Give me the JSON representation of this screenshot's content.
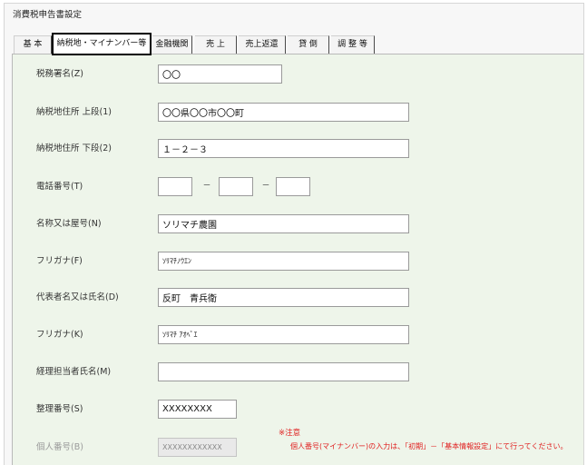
{
  "window": {
    "title": "消費税申告書設定"
  },
  "tabs": [
    {
      "label": "基 本",
      "selected": false
    },
    {
      "label": "納税地・マイナンバー等",
      "selected": true
    },
    {
      "label": "金融機関",
      "selected": false
    },
    {
      "label": "売 上",
      "selected": false
    },
    {
      "label": "売上返還",
      "selected": false
    },
    {
      "label": "貸 倒",
      "selected": false
    },
    {
      "label": "調 整 等",
      "selected": false
    }
  ],
  "form": {
    "tax_office": {
      "label": "税務署名(Z)",
      "value": "〇〇"
    },
    "address_upper": {
      "label": "納税地住所 上段(1)",
      "value": "〇〇県〇〇市〇〇町"
    },
    "address_lower": {
      "label": "納税地住所 下段(2)",
      "value": "１－２－３"
    },
    "phone": {
      "label": "電話番号(T)",
      "part1": "",
      "part2": "",
      "part3": "",
      "separator": "－"
    },
    "name": {
      "label": "名称又は屋号(N)",
      "value": "ソリマチ農園"
    },
    "name_kana": {
      "label": "フリガナ(F)",
      "value": "ｿﾘﾏﾁﾉｳｴﾝ"
    },
    "representative": {
      "label": "代表者名又は氏名(D)",
      "value": "反町　青兵衛"
    },
    "representative_kana": {
      "label": "フリガナ(K)",
      "value": "ｿﾘﾏﾁ ｱｵﾍﾞｴ"
    },
    "accountant": {
      "label": "経理担当者氏名(M)",
      "value": ""
    },
    "reference_number": {
      "label": "整理番号(S)",
      "value": "XXXXXXXX"
    },
    "my_number": {
      "label": "個人番号(B)",
      "value": "XXXXXXXXXXXX",
      "disabled": true
    }
  },
  "notice": {
    "heading": "※注意",
    "text": "個人番号(マイナンバー)の入力は、「初期」－「基本情報設定」にて行ってください。"
  },
  "colors": {
    "panel_background": "#eef5ea",
    "notice_text": "#e02020",
    "selected_tab_border": "#000000"
  }
}
